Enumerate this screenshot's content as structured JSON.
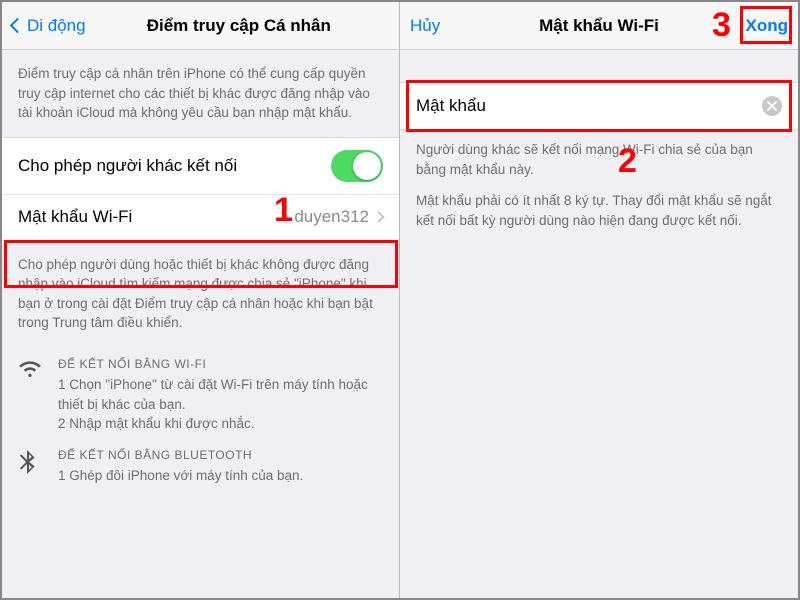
{
  "left": {
    "nav_back": "Di động",
    "nav_title": "Điểm truy cập Cá nhân",
    "intro": "Điểm truy cập cá nhân trên iPhone có thể cung cấp quyền truy cập internet cho các thiết bị khác được đăng nhập vào tài khoản iCloud mà không yêu cầu bạn nhập mật khẩu.",
    "allow_label": "Cho phép người khác kết nối",
    "allow_on": true,
    "wifi_pw_label": "Mật khẩu Wi-Fi",
    "wifi_pw_value": "duyen312",
    "allow_desc": "Cho phép người dùng hoặc thiết bị khác không được đăng nhập vào iCloud tìm kiếm mạng được chia sẻ \"iPhone\" khi bạn ở trong cài đặt Điểm truy cập cá nhân hoặc khi bạn bật trong Trung tâm điều khiển.",
    "wifi_title": "ĐỂ KẾT NỐI BẰNG WI-FI",
    "wifi_step1": "1 Chọn \"iPhone\" từ cài đặt Wi-Fi trên máy tính hoặc thiết bị khác của bạn.",
    "wifi_step2": "2 Nhập mật khẩu khi được nhắc.",
    "bt_title": "ĐỂ KẾT NỐI BẰNG BLUETOOTH",
    "bt_step1": "1 Ghép đôi iPhone với máy tính của bạn."
  },
  "right": {
    "nav_cancel": "Hủy",
    "nav_title": "Mật khẩu Wi-Fi",
    "nav_done": "Xong",
    "pw_label": "Mật khẩu",
    "pw_value": "",
    "desc1": "Người dùng khác sẽ kết nối mạng Wi-Fi chia sẻ của bạn bằng mật khẩu này.",
    "desc2": "Mật khẩu phải có ít nhất 8 ký tự. Thay đổi mật khẩu sẽ ngắt kết nối bất kỳ người dùng nào hiện đang được kết nối."
  },
  "annotations": {
    "n1": "1",
    "n2": "2",
    "n3": "3"
  }
}
